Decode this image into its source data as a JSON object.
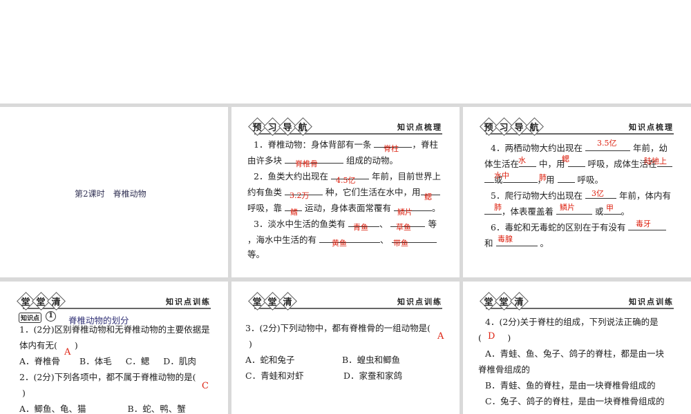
{
  "lesson_title": "第2课时　脊椎动物",
  "header_preview": {
    "chars": [
      "预",
      "习",
      "导",
      "航"
    ],
    "right": "知识点梳理"
  },
  "header_class": {
    "chars": [
      "堂",
      "堂",
      "清"
    ],
    "right": "知识点训练"
  },
  "p2": {
    "l1a": "1．脊椎动物：身体背部有一条",
    "l1b": "，脊柱",
    "l2a": "由许多块",
    "l2b": "组成的动物。",
    "l3a": "2．鱼类大约出现在",
    "l3b": "年前，目前世界上",
    "l4a": "约有鱼类",
    "l4b": "种，它们生活在水中，用",
    "l5a": "呼吸，靠",
    "l5b": "运动，身体表面常覆有",
    "l5c": "。",
    "l6a": "3．淡水中生活的鱼类有",
    "l6b": "、",
    "l6c": "等",
    "l7a": "，海水中生活的有",
    "l7b": "、",
    "l8": "等。",
    "answers": [
      "脊柱",
      "脊椎骨",
      "4.5亿",
      "3.2万",
      "鳃",
      "鳍",
      "鳞片",
      "青鱼",
      "草鱼",
      "黄鱼",
      "带鱼"
    ]
  },
  "p3": {
    "l1a": "4．两栖动物大约出现在",
    "l1b": "年前，幼",
    "l2a": "体生活在",
    "l2b": "中，用",
    "l2c": "呼吸，成体生活在",
    "l3a": "或",
    "l3b": "，用",
    "l3c": "呼吸。",
    "l4a": "5．爬行动物大约出现在",
    "l4b": "年前，体内有",
    "l5a": "，体表覆盖着",
    "l5b": "或",
    "l5c": "。",
    "l6a": "6．毒蛇和无毒蛇的区别在于有没有",
    "l7a": "和",
    "l7b": "。",
    "answers": [
      "3.5亿",
      "水",
      "鳃",
      "陆地上",
      "水中",
      "肺",
      "3亿",
      "肺",
      "鳞片",
      "甲",
      "毒牙",
      "毒腺"
    ]
  },
  "p4": {
    "kp_label": "知识点",
    "kp_num": "1",
    "section": "脊椎动物的划分",
    "q1a": "1．(2分)区别脊椎动物和无脊椎动物的主要依据是",
    "q1b": "体内有无(　　)",
    "q1ans": "A",
    "q1opts": [
      "A．脊椎骨",
      "B．体毛",
      "C．鳃",
      "D．肌肉"
    ],
    "q2a": "2．(2分)下列各项中，都不属于脊椎动物的是(",
    "q2b": ")",
    "q2ans": "C",
    "q2opts": [
      "A．鲫鱼、龟、猫",
      "B．蛇、鸭、蟹"
    ]
  },
  "p5": {
    "q3a": "3．(2分)下列动物中，都有脊椎骨的一组动物是(",
    "q3b": ")",
    "q3ans": "A",
    "q3opts": [
      "A．蛇和兔子",
      "B．蝗虫和鲫鱼",
      "C．青蛙和对虾",
      "D．家蚕和家鸽"
    ]
  },
  "p6": {
    "q4a": "4．(2分)关于脊柱的组成，下列说法正确的是",
    "q4b": "(　　　)",
    "q4ans": "D",
    "optA1": "A．青蛙、鱼、兔子、鸽子的脊柱，都是由一块",
    "optA2": "脊椎骨组成的",
    "optB": "B．青蛙、鱼的脊柱，是由一块脊椎骨组成的",
    "optC": "C．兔子、鸽子的脊柱，是由一块脊椎骨组成的"
  }
}
